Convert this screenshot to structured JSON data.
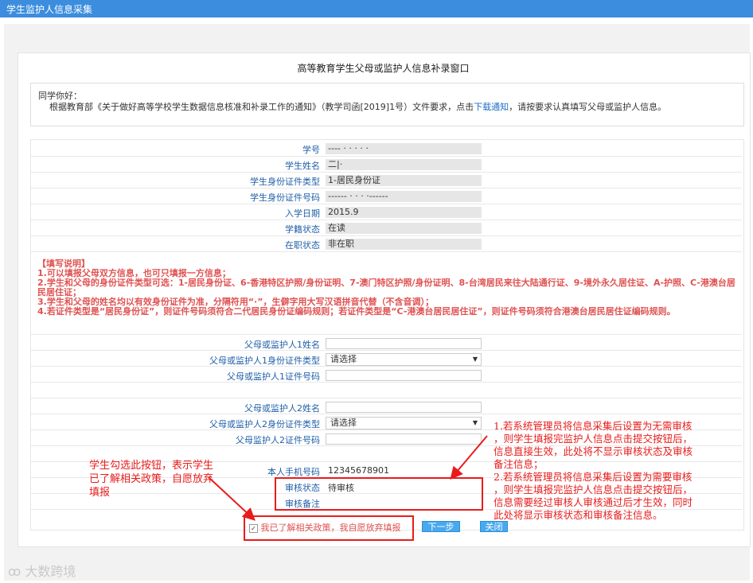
{
  "app": {
    "title": "学生监护人信息采集"
  },
  "window_title": "高等教育学生父母或监护人信息补录窗口",
  "notice": {
    "greeting": "同学你好：",
    "body_prefix": "根据教育部《关于做好高等学校学生数据信息核准和补录工作的通知》（教学司函[2019]1号）文件要求，点击",
    "link_text": "下载通知",
    "body_suffix": "，请按要求认真填写父母或监护人信息。"
  },
  "student": {
    "student_id_label": "学号",
    "student_id_value": "----  ·  ·  ·  ·  ·",
    "name_label": "学生姓名",
    "name_value": "二|·",
    "id_type_label": "学生身份证件类型",
    "id_type_value": "1-居民身份证",
    "id_number_label": "学生身份证件号码",
    "id_number_value": "------ · · ·  ·------",
    "enroll_date_label": "入学日期",
    "enroll_date_value": "2015.9",
    "status_label": "学籍状态",
    "status_value": "在读",
    "job_status_label": "在职状态",
    "job_status_value": "非在职"
  },
  "instructions": [
    "【填写说明】",
    "1.可以填报父母双方信息，也可只填报一方信息；",
    "2.学生和父母的身份证件类型可选：1-居民身份证、6-香港特区护照/身份证明、7-澳门特区护照/身份证明、8-台湾居民来往大陆通行证、9-境外永久居住证、A-护照、C-港澳台居民居住证；",
    "3.学生和父母的姓名均以有效身份证件为准，分隔符用“·”，生僻字用大写汉语拼音代替（不含音调）；",
    "4.若证件类型是“居民身份证”，则证件号码须符合二代居民身份证编码规则；若证件类型是“C-港澳台居民居住证”，则证件号码须符合港澳台居民居住证编码规则。"
  ],
  "guardian1": {
    "name_label": "父母或监护人1姓名",
    "id_type_label": "父母或监护人1身份证件类型",
    "id_type_selected": "请选择",
    "id_number_label": "父母或监护人1证件号码"
  },
  "guardian2": {
    "name_label": "父母或监护人2姓名",
    "id_type_label": "父母或监护人2身份证件类型",
    "id_type_selected": "请选择",
    "id_number_label": "父母监护人2证件号码"
  },
  "contact": {
    "phone_label": "本人手机号码",
    "phone_value": "12345678901"
  },
  "review": {
    "status_label": "审核状态",
    "status_value": "待审核",
    "remark_label": "审核备注",
    "remark_value": ""
  },
  "waiver": {
    "checked": true,
    "label": "我已了解相关政策，我自愿放弃填报"
  },
  "buttons": {
    "next": "下一步",
    "close": "关闭"
  },
  "annotations": {
    "left": [
      "学生勾选此按钮，表示学生",
      "已了解相关政策，自愿放弃",
      "填报"
    ],
    "right": [
      "1.若系统管理员将信息采集后设置为无需审核",
      "，则学生填报完监护人信息点击提交按钮后，",
      "信息直接生效，此处将不显示审核状态及审核",
      "备注信息；",
      "2.若系统管理员将信息采集后设置为需要审核",
      "，则学生填报完监护人信息点击提交按钮后，",
      "信息需要经过审核人审核通过后才生效，同时",
      "此处将显示审核状态和审核备注信息。"
    ]
  },
  "watermark": "大数跨境",
  "colors": {
    "header": "#3c8dde",
    "label": "#1f5fa8",
    "instruction": "#e05252",
    "annotation": "#e81c1c",
    "button": "#49a9ee"
  }
}
